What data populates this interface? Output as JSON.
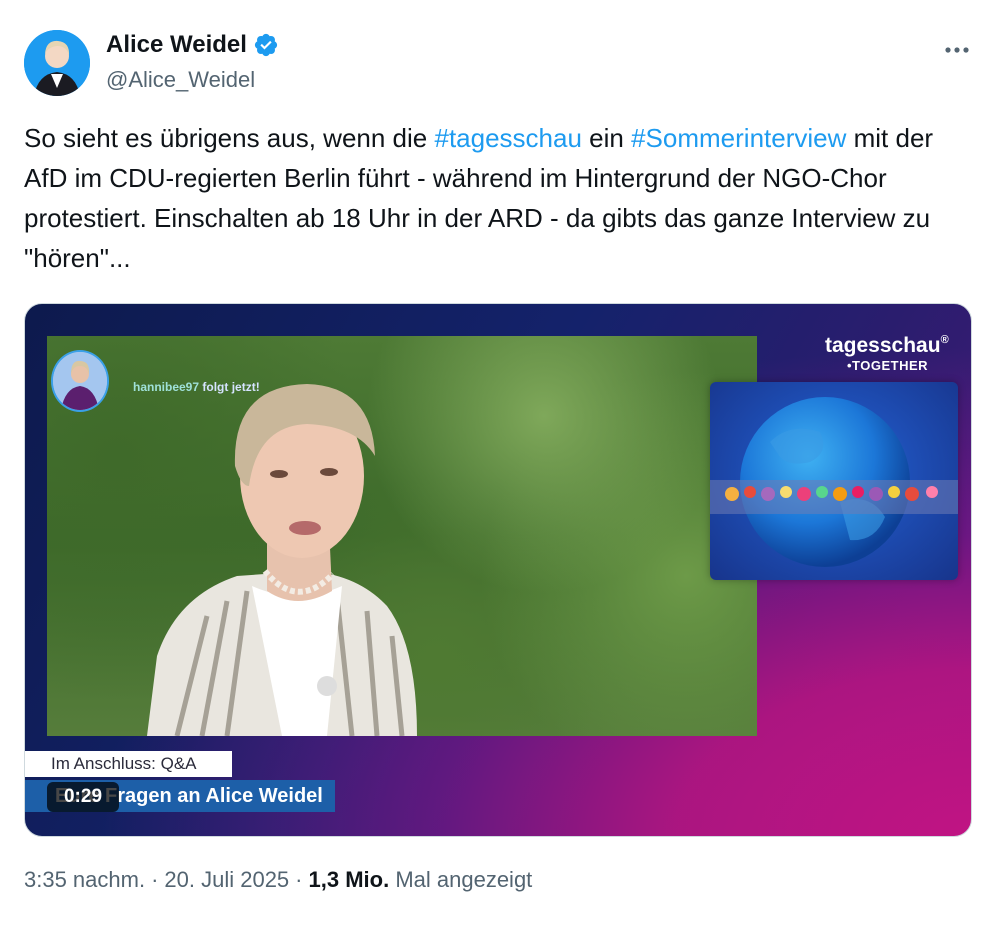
{
  "author": {
    "name": "Alice Weidel",
    "handle": "@Alice_Weidel",
    "verified": true
  },
  "more_icon": "more-horizontal-icon",
  "tweet": {
    "line1_pre": "So sieht es übrigens aus, wenn die ",
    "hashtag1": "#tagesschau",
    "line1_mid": " ein ",
    "hashtag2": "#Sommerinterview",
    "rest": "mit der AfD im CDU-regierten Berlin führt - während im Hintergrund der NGO-Chor protestiert. Einschalten ab 18 Uhr in der ARD - da gibts das ganze Interview zu \"hören\"..."
  },
  "video": {
    "overlay_user": "hannibee97",
    "overlay_follow": "folgt jetzt!",
    "brand": "tagesschau",
    "brand_reg": "®",
    "brand_sub": "•TOGETHER",
    "lower_third_tag": "Im Anschluss: Q&A",
    "lower_third_title": "Eure Fragen an Alice Weidel",
    "timer": "0:29"
  },
  "meta": {
    "time": "3:35 nachm.",
    "date": "20. Juli 2025",
    "views": "1,3 Mio.",
    "views_label": "Mal angezeigt"
  },
  "colors": {
    "accent": "#1d9bf0",
    "secondary_text": "#536471",
    "primary_text": "#0f1419"
  }
}
